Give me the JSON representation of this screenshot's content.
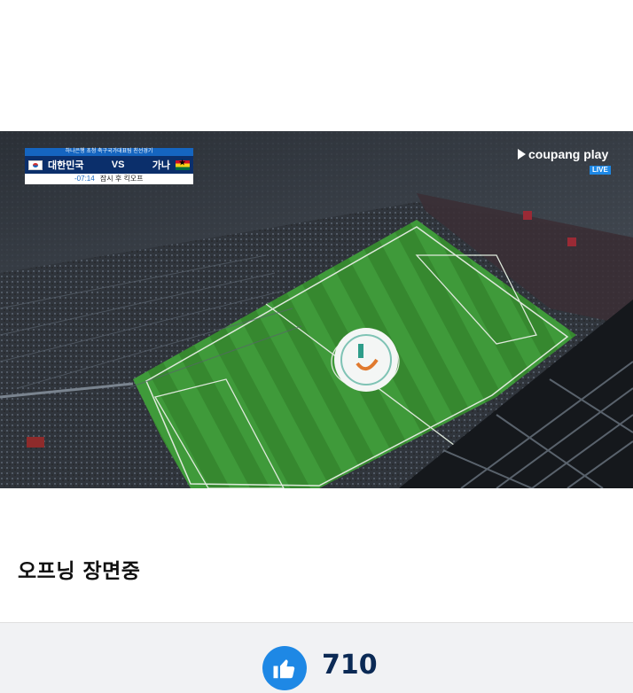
{
  "video": {
    "description_icon": "stadium-aerial-view",
    "scoreboard": {
      "sponsor": "하나은행 초청 축구국가대표팀 친선경기",
      "home_team": "대한민국",
      "vs": "VS",
      "away_team": "가나",
      "clock": "-07:14",
      "status": "잠시 후 킥오프"
    },
    "broadcaster": {
      "name": "coupang play",
      "live_badge": "LIVE"
    }
  },
  "caption": "오프닝 장면중",
  "like": {
    "icon": "thumbs-up-icon",
    "count": "710",
    "accent": "#1e88e5"
  }
}
